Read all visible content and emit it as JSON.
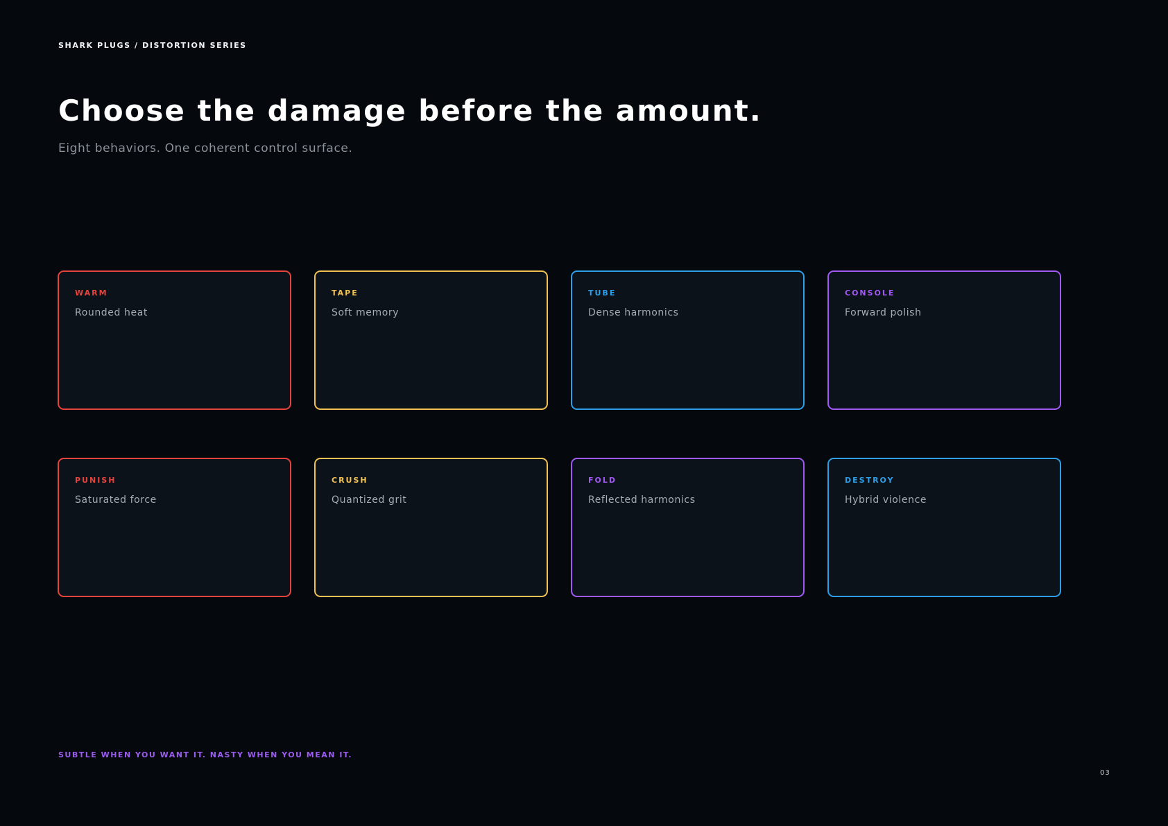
{
  "header": {
    "eyebrow": "SHARK PLUGS / DISTORTION SERIES",
    "title": "Choose the damage before the amount.",
    "subtitle": "Eight behaviors. One coherent control surface."
  },
  "cards": [
    {
      "tag": "WARM",
      "description": "Rounded heat",
      "color": "#e5443d"
    },
    {
      "tag": "TAPE",
      "description": "Soft memory",
      "color": "#f2c154"
    },
    {
      "tag": "TUBE",
      "description": "Dense harmonics",
      "color": "#2e9ee6"
    },
    {
      "tag": "CONSOLE",
      "description": "Forward polish",
      "color": "#a05af2"
    },
    {
      "tag": "PUNISH",
      "description": "Saturated force",
      "color": "#e5443d"
    },
    {
      "tag": "CRUSH",
      "description": "Quantized grit",
      "color": "#f2c154"
    },
    {
      "tag": "FOLD",
      "description": "Reflected harmonics",
      "color": "#a05af2"
    },
    {
      "tag": "DESTROY",
      "description": "Hybrid violence",
      "color": "#2e9ee6"
    }
  ],
  "footer": {
    "tagline": "SUBTLE WHEN YOU WANT IT. NASTY WHEN YOU MEAN IT.",
    "page_number": "03"
  },
  "colors": {
    "background": "#05080c",
    "card_background": "#0c1219",
    "accent_purple": "#9b5cf0",
    "text_primary": "#ffffff",
    "text_secondary": "#8c939c"
  }
}
